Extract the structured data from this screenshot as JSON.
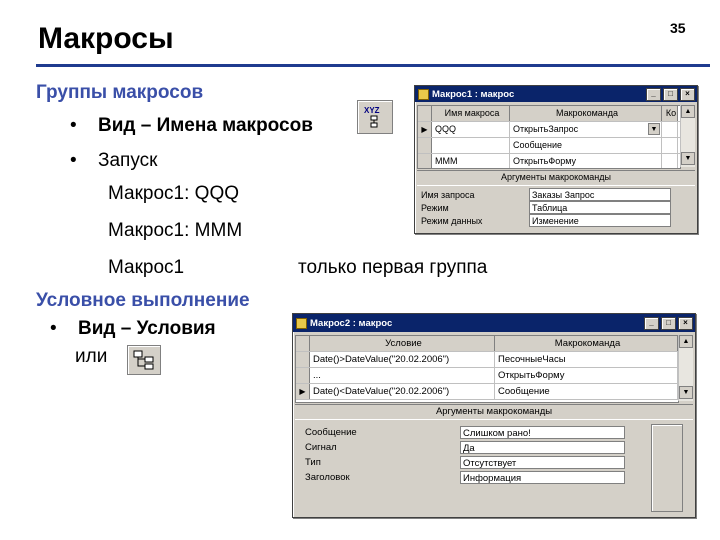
{
  "slide": {
    "title": "Макросы",
    "page_number": "35"
  },
  "content": {
    "section1": "Группы макросов",
    "bullet1_bold": "Вид – Имена макросов",
    "bullet2": "Запуск",
    "run1": "Макрос1: QQQ",
    "run2": "Макрос1: MMM",
    "run3": "Макрос1",
    "run3_note": "только первая группа",
    "section2": "Условное выполнение",
    "bullet3_bold": "Вид – Условия",
    "or_text": "или"
  },
  "icons": {
    "macro_names_icon": "macro-names-icon",
    "conditions_icon": "conditions-icon"
  },
  "window1": {
    "title": "Макрос1 : макрос",
    "columns": [
      "Имя макроса",
      "Макрокоманда",
      "Ко"
    ],
    "rows": [
      {
        "name": "QQQ",
        "action": "ОткрытьЗапрос"
      },
      {
        "name": "",
        "action": "Сообщение"
      },
      {
        "name": "MMM",
        "action": "ОткрытьФорму"
      }
    ],
    "args_header": "Аргументы макрокоманды",
    "args": [
      {
        "label": "Имя запроса",
        "value": "Заказы Запрос"
      },
      {
        "label": "Режим",
        "value": "Таблица"
      },
      {
        "label": "Режим данных",
        "value": "Изменение"
      }
    ]
  },
  "window2": {
    "title": "Макрос2 : макрос",
    "columns": [
      "Условие",
      "Макрокоманда"
    ],
    "rows": [
      {
        "cond": "Date()>DateValue(\"20.02.2006\")",
        "action": "ПесочныеЧасы"
      },
      {
        "cond": "...",
        "action": "ОткрытьФорму"
      },
      {
        "cond": "Date()<DateValue(\"20.02.2006\")",
        "action": "Сообщение"
      }
    ],
    "args_header": "Аргументы макрокоманды",
    "args": [
      {
        "label": "Сообщение",
        "value": "Слишком рано!"
      },
      {
        "label": "Сигнал",
        "value": "Да"
      },
      {
        "label": "Тип",
        "value": "Отсутствует"
      },
      {
        "label": "Заголовок",
        "value": "Информация"
      }
    ]
  },
  "colors": {
    "accent": "#3a4fa8",
    "rule": "#1f3b8f",
    "titlebar": "#0a246a",
    "window_bg": "#d4d0c8"
  }
}
